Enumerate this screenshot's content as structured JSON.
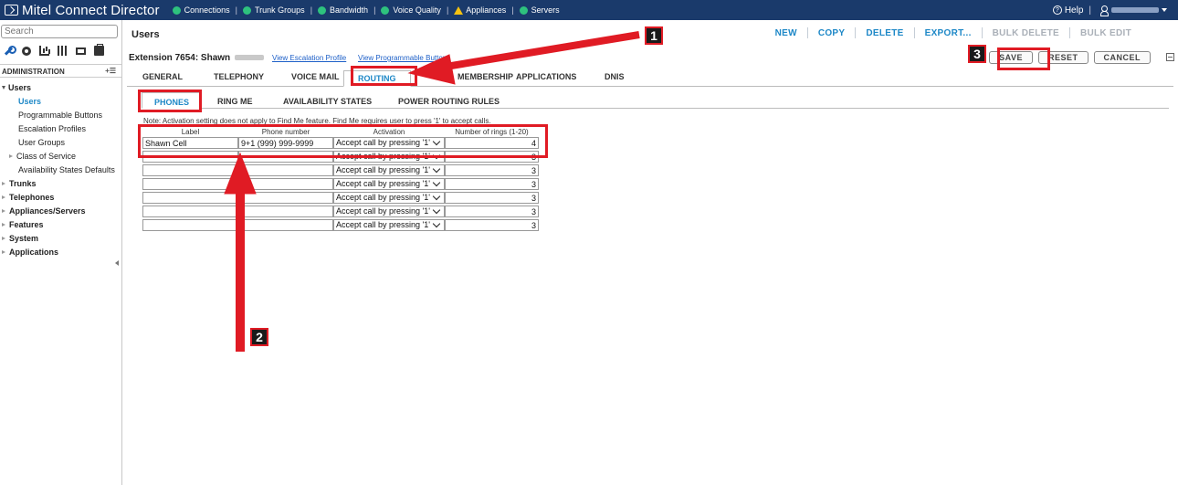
{
  "app": {
    "title_thin": "Mitel",
    "title_bold": "Connect Director",
    "status_items": [
      {
        "label": "Connections",
        "status": "ok"
      },
      {
        "label": "Trunk Groups",
        "status": "ok"
      },
      {
        "label": "Bandwidth",
        "status": "ok"
      },
      {
        "label": "Voice Quality",
        "status": "ok"
      },
      {
        "label": "Appliances",
        "status": "warning"
      },
      {
        "label": "Servers",
        "status": "ok"
      }
    ],
    "separator": "|",
    "help_label": "Help",
    "colors": {
      "header_bg": "#1a3a6b",
      "ok": "#2ec27e",
      "warning": "#f5c211",
      "accent": "#1e88c7",
      "annotation": "#e01b24"
    }
  },
  "sidebar": {
    "search_placeholder": "Search",
    "toolbar_icons": [
      "wrench-icon",
      "gear-icon",
      "chart-icon",
      "barcode-icon",
      "switch-icon",
      "toolbox-icon"
    ],
    "section_title": "ADMINISTRATION",
    "section_expand": "+☰",
    "tree": [
      {
        "label": "Users",
        "level": 0,
        "expanded": true
      },
      {
        "label": "Users",
        "level": 1,
        "selected": true
      },
      {
        "label": "Programmable Buttons",
        "level": 1
      },
      {
        "label": "Escalation Profiles",
        "level": 1
      },
      {
        "label": "User Groups",
        "level": 1
      },
      {
        "label": "Class of Service",
        "level": 1,
        "collapsed": true
      },
      {
        "label": "Availability States Defaults",
        "level": 1
      },
      {
        "label": "Trunks",
        "level": 0
      },
      {
        "label": "Telephones",
        "level": 0
      },
      {
        "label": "Appliances/Servers",
        "level": 0
      },
      {
        "label": "Features",
        "level": 0
      },
      {
        "label": "System",
        "level": 0
      },
      {
        "label": "Applications",
        "level": 0
      }
    ]
  },
  "main": {
    "page_title": "Users",
    "actions": [
      {
        "label": "NEW",
        "enabled": true
      },
      {
        "label": "COPY",
        "enabled": true
      },
      {
        "label": "DELETE",
        "enabled": true
      },
      {
        "label": "EXPORT...",
        "enabled": true
      },
      {
        "label": "BULK DELETE",
        "enabled": false
      },
      {
        "label": "BULK EDIT",
        "enabled": false
      }
    ],
    "extension_title": "Extension 7654: Shawn",
    "links": {
      "escalation": "View Escalation Profile",
      "buttons": "View Programmable Buttons"
    },
    "buttons": {
      "save": "SAVE",
      "reset": "RESET",
      "cancel": "CANCEL"
    },
    "tabs": [
      "GENERAL",
      "TELEPHONY",
      "VOICE MAIL",
      "ROUTING",
      "MEMBERSHIP",
      "APPLICATIONS",
      "DNIS"
    ],
    "active_tab": "ROUTING",
    "subtabs": [
      "PHONES",
      "RING ME",
      "AVAILABILITY STATES",
      "POWER ROUTING RULES"
    ],
    "active_subtab": "PHONES",
    "note": "Note: Activation setting does not apply to Find Me feature. Find Me requires user to press '1' to accept calls.",
    "table": {
      "headers": [
        "Label",
        "Phone number",
        "Activation",
        "Number of rings (1-20)"
      ],
      "rows": [
        {
          "label": "Shawn Cell",
          "phone": "9+1 (999) 999-9999",
          "activation": "Accept call by pressing '1'",
          "rings": "4"
        },
        {
          "label": "",
          "phone": "",
          "activation": "Accept call by pressing '1'",
          "rings": "3"
        },
        {
          "label": "",
          "phone": "",
          "activation": "Accept call by pressing '1'",
          "rings": "3"
        },
        {
          "label": "",
          "phone": "",
          "activation": "Accept call by pressing '1'",
          "rings": "3"
        },
        {
          "label": "",
          "phone": "",
          "activation": "Accept call by pressing '1'",
          "rings": "3"
        },
        {
          "label": "",
          "phone": "",
          "activation": "Accept call by pressing '1'",
          "rings": "3"
        },
        {
          "label": "",
          "phone": "",
          "activation": "Accept call by pressing '1'",
          "rings": "3"
        }
      ]
    }
  },
  "annotations": {
    "labels": [
      "1",
      "2",
      "3"
    ]
  }
}
